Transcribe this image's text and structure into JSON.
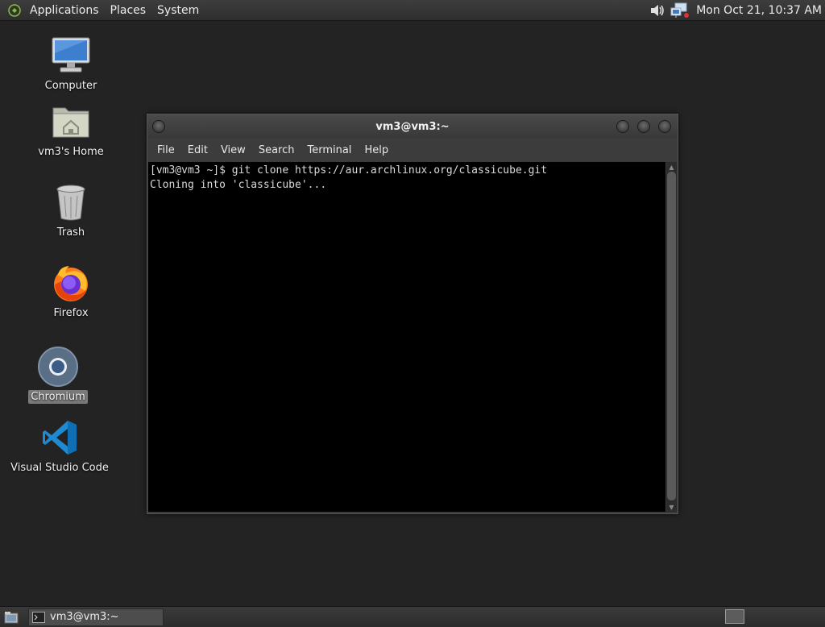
{
  "top_panel": {
    "menus": [
      "Applications",
      "Places",
      "System"
    ],
    "clock": "Mon Oct 21, 10:37 AM",
    "tray_icons": [
      "speaker-icon",
      "network-icon"
    ]
  },
  "desktop": {
    "icons": [
      {
        "label": "Computer",
        "icon": "computer-icon"
      },
      {
        "label": "vm3's Home",
        "icon": "home-folder-icon"
      },
      {
        "label": "Trash",
        "icon": "trash-icon"
      },
      {
        "label": "Firefox",
        "icon": "firefox-icon"
      },
      {
        "label": "Chromium",
        "icon": "chromium-icon",
        "selected": true
      },
      {
        "label": "Visual Studio Code",
        "icon": "vscode-icon"
      }
    ]
  },
  "terminal": {
    "title": "vm3@vm3:~",
    "menu": [
      "File",
      "Edit",
      "View",
      "Search",
      "Terminal",
      "Help"
    ],
    "lines": [
      "[vm3@vm3 ~]$ git clone https://aur.archlinux.org/classicube.git",
      "Cloning into 'classicube'..."
    ]
  },
  "taskbar": {
    "tasks": [
      {
        "label": "vm3@vm3:~",
        "icon": "terminal-icon"
      }
    ]
  },
  "colors": {
    "desktop_bg": "#232323",
    "terminal_bg": "#000000",
    "panel_bg": "#353535"
  }
}
